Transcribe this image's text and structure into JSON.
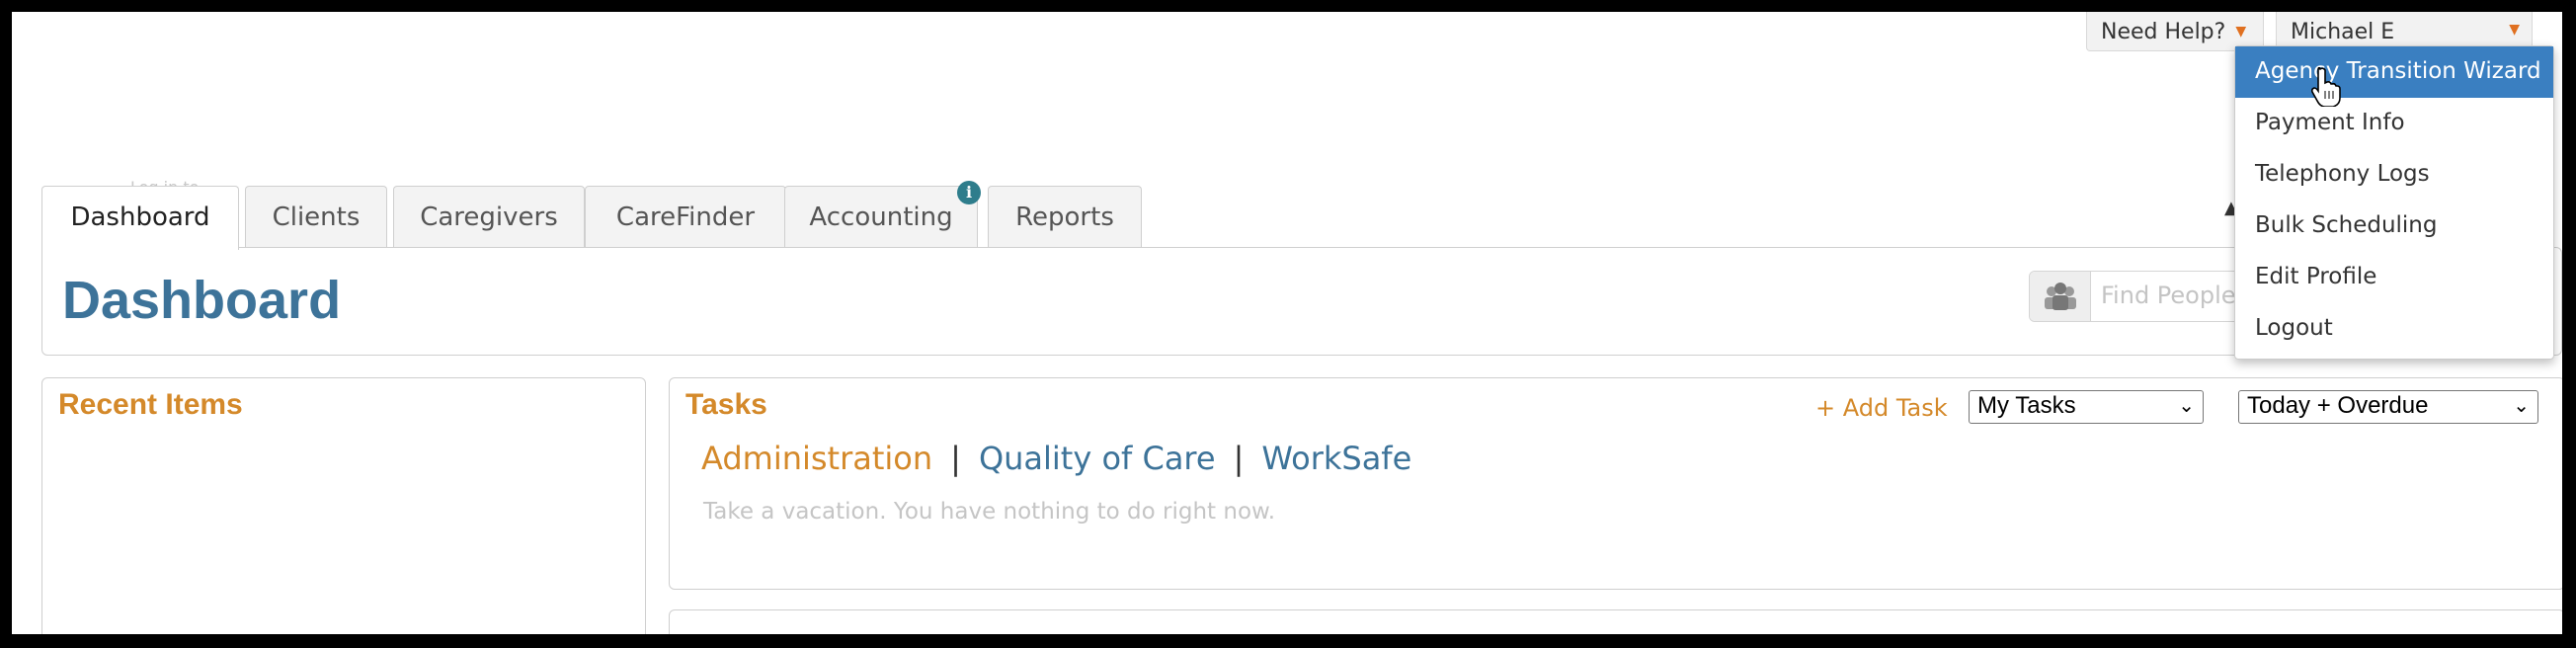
{
  "top_bar": {
    "help_label": "Need Help?",
    "user_label": "Michael E"
  },
  "ghost_text": "Log in to ...",
  "tabs": [
    {
      "label": "Dashboard",
      "active": true
    },
    {
      "label": "Clients"
    },
    {
      "label": "Caregivers"
    },
    {
      "label": "CareFinder"
    },
    {
      "label": "Accounting",
      "badge": "i"
    },
    {
      "label": "Reports"
    }
  ],
  "page": {
    "title": "Dashboard"
  },
  "find": {
    "placeholder": "Find People"
  },
  "recent": {
    "title": "Recent Items"
  },
  "tasks": {
    "title": "Tasks",
    "add_label": "+ Add Task",
    "filter_selected": "My Tasks",
    "range_selected": "Today + Overdue",
    "categories": [
      "Administration",
      "Quality of Care",
      "WorkSafe"
    ],
    "separator": "|",
    "empty_message": "Take a vacation. You have nothing to do right now."
  },
  "user_menu": {
    "items": [
      "Agency Transition Wizard",
      "Payment Info",
      "Telephony Logs",
      "Bulk Scheduling",
      "Edit Profile",
      "Logout"
    ]
  },
  "colors": {
    "accent_orange": "#d4892a",
    "title_blue": "#3d7399",
    "menu_highlight": "#3a7fc1"
  }
}
